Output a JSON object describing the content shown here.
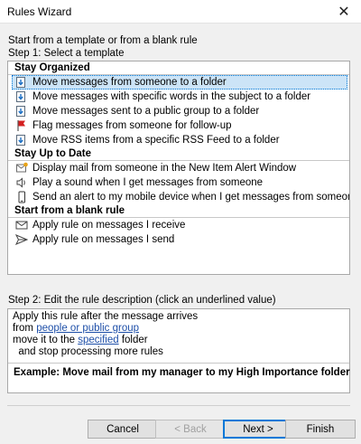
{
  "window": {
    "title": "Rules Wizard"
  },
  "intro": "Start from a template or from a blank rule",
  "step1": "Step 1: Select a template",
  "groups": [
    {
      "name": "Stay Organized",
      "items": [
        {
          "label": "Move messages from someone to a folder",
          "icon": "folder-move-icon",
          "selected": true
        },
        {
          "label": "Move messages with specific words in the subject to a folder",
          "icon": "folder-move-icon"
        },
        {
          "label": "Move messages sent to a public group to a folder",
          "icon": "folder-move-icon"
        },
        {
          "label": "Flag messages from someone for follow-up",
          "icon": "red-flag-icon"
        },
        {
          "label": "Move RSS items from a specific RSS Feed to a folder",
          "icon": "folder-move-icon"
        }
      ]
    },
    {
      "name": "Stay Up to Date",
      "items": [
        {
          "label": "Display mail from someone in the New Item Alert Window",
          "icon": "alert-window-icon"
        },
        {
          "label": "Play a sound when I get messages from someone",
          "icon": "speaker-icon"
        },
        {
          "label": "Send an alert to my mobile device when I get messages from someone",
          "icon": "mobile-phone-icon"
        }
      ]
    },
    {
      "name": "Start from a blank rule",
      "items": [
        {
          "label": "Apply rule on messages I receive",
          "icon": "envelope-icon"
        },
        {
          "label": "Apply rule on messages I send",
          "icon": "send-arrow-icon"
        }
      ]
    }
  ],
  "step2": "Step 2: Edit the rule description (click an underlined value)",
  "description": {
    "line1": "Apply this rule after the message arrives",
    "line2_prefix": "from ",
    "line2_link": "people or public group",
    "line3_prefix": "move it to the ",
    "line3_link": "specified",
    "line3_suffix": " folder",
    "line4": "  and stop processing more rules",
    "example": "Example: Move mail from my manager to my High Importance folder"
  },
  "buttons": {
    "cancel": "Cancel",
    "back": "< Back",
    "next": "Next >",
    "finish": "Finish"
  },
  "colors": {
    "selection": "#cce4f7",
    "accent": "#0078d7",
    "link": "#1e4fa8",
    "flag": "#d42020"
  }
}
